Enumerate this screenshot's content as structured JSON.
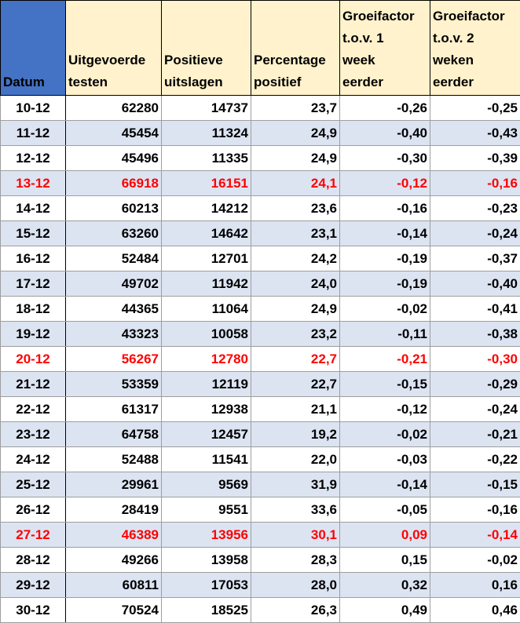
{
  "headers": {
    "datum": "Datum",
    "testen": "Uitgevoerde\ntesten",
    "positief": "Positieve\nuitslagen",
    "percentage": "Percentage\npositief",
    "groei1": "Groeifactor\nt.o.v. 1\nweek\neerder",
    "groei2": "Groeifactor\nt.o.v. 2\nweken\neerder"
  },
  "colors": {
    "header_date_bg": "#4472c4",
    "header_bg": "#fff2cc",
    "band": "#dce4f2",
    "highlight": "#ff0000"
  },
  "rows": [
    {
      "datum": "10-12",
      "testen": "62280",
      "positief": "14737",
      "percentage": "23,7",
      "groei1": "-0,26",
      "groei2": "-0,25",
      "highlight": false
    },
    {
      "datum": "11-12",
      "testen": "45454",
      "positief": "11324",
      "percentage": "24,9",
      "groei1": "-0,40",
      "groei2": "-0,43",
      "highlight": false
    },
    {
      "datum": "12-12",
      "testen": "45496",
      "positief": "11335",
      "percentage": "24,9",
      "groei1": "-0,30",
      "groei2": "-0,39",
      "highlight": false
    },
    {
      "datum": "13-12",
      "testen": "66918",
      "positief": "16151",
      "percentage": "24,1",
      "groei1": "-0,12",
      "groei2": "-0,16",
      "highlight": true
    },
    {
      "datum": "14-12",
      "testen": "60213",
      "positief": "14212",
      "percentage": "23,6",
      "groei1": "-0,16",
      "groei2": "-0,23",
      "highlight": false
    },
    {
      "datum": "15-12",
      "testen": "63260",
      "positief": "14642",
      "percentage": "23,1",
      "groei1": "-0,14",
      "groei2": "-0,24",
      "highlight": false
    },
    {
      "datum": "16-12",
      "testen": "52484",
      "positief": "12701",
      "percentage": "24,2",
      "groei1": "-0,19",
      "groei2": "-0,37",
      "highlight": false
    },
    {
      "datum": "17-12",
      "testen": "49702",
      "positief": "11942",
      "percentage": "24,0",
      "groei1": "-0,19",
      "groei2": "-0,40",
      "highlight": false
    },
    {
      "datum": "18-12",
      "testen": "44365",
      "positief": "11064",
      "percentage": "24,9",
      "groei1": "-0,02",
      "groei2": "-0,41",
      "highlight": false
    },
    {
      "datum": "19-12",
      "testen": "43323",
      "positief": "10058",
      "percentage": "23,2",
      "groei1": "-0,11",
      "groei2": "-0,38",
      "highlight": false
    },
    {
      "datum": "20-12",
      "testen": "56267",
      "positief": "12780",
      "percentage": "22,7",
      "groei1": "-0,21",
      "groei2": "-0,30",
      "highlight": true
    },
    {
      "datum": "21-12",
      "testen": "53359",
      "positief": "12119",
      "percentage": "22,7",
      "groei1": "-0,15",
      "groei2": "-0,29",
      "highlight": false
    },
    {
      "datum": "22-12",
      "testen": "61317",
      "positief": "12938",
      "percentage": "21,1",
      "groei1": "-0,12",
      "groei2": "-0,24",
      "highlight": false
    },
    {
      "datum": "23-12",
      "testen": "64758",
      "positief": "12457",
      "percentage": "19,2",
      "groei1": "-0,02",
      "groei2": "-0,21",
      "highlight": false
    },
    {
      "datum": "24-12",
      "testen": "52488",
      "positief": "11541",
      "percentage": "22,0",
      "groei1": "-0,03",
      "groei2": "-0,22",
      "highlight": false
    },
    {
      "datum": "25-12",
      "testen": "29961",
      "positief": "9569",
      "percentage": "31,9",
      "groei1": "-0,14",
      "groei2": "-0,15",
      "highlight": false
    },
    {
      "datum": "26-12",
      "testen": "28419",
      "positief": "9551",
      "percentage": "33,6",
      "groei1": "-0,05",
      "groei2": "-0,16",
      "highlight": false
    },
    {
      "datum": "27-12",
      "testen": "46389",
      "positief": "13956",
      "percentage": "30,1",
      "groei1": "0,09",
      "groei2": "-0,14",
      "highlight": true
    },
    {
      "datum": "28-12",
      "testen": "49266",
      "positief": "13958",
      "percentage": "28,3",
      "groei1": "0,15",
      "groei2": "-0,02",
      "highlight": false
    },
    {
      "datum": "29-12",
      "testen": "60811",
      "positief": "17053",
      "percentage": "28,0",
      "groei1": "0,32",
      "groei2": "0,16",
      "highlight": false
    },
    {
      "datum": "30-12",
      "testen": "70524",
      "positief": "18525",
      "percentage": "26,3",
      "groei1": "0,49",
      "groei2": "0,46",
      "highlight": false
    }
  ]
}
